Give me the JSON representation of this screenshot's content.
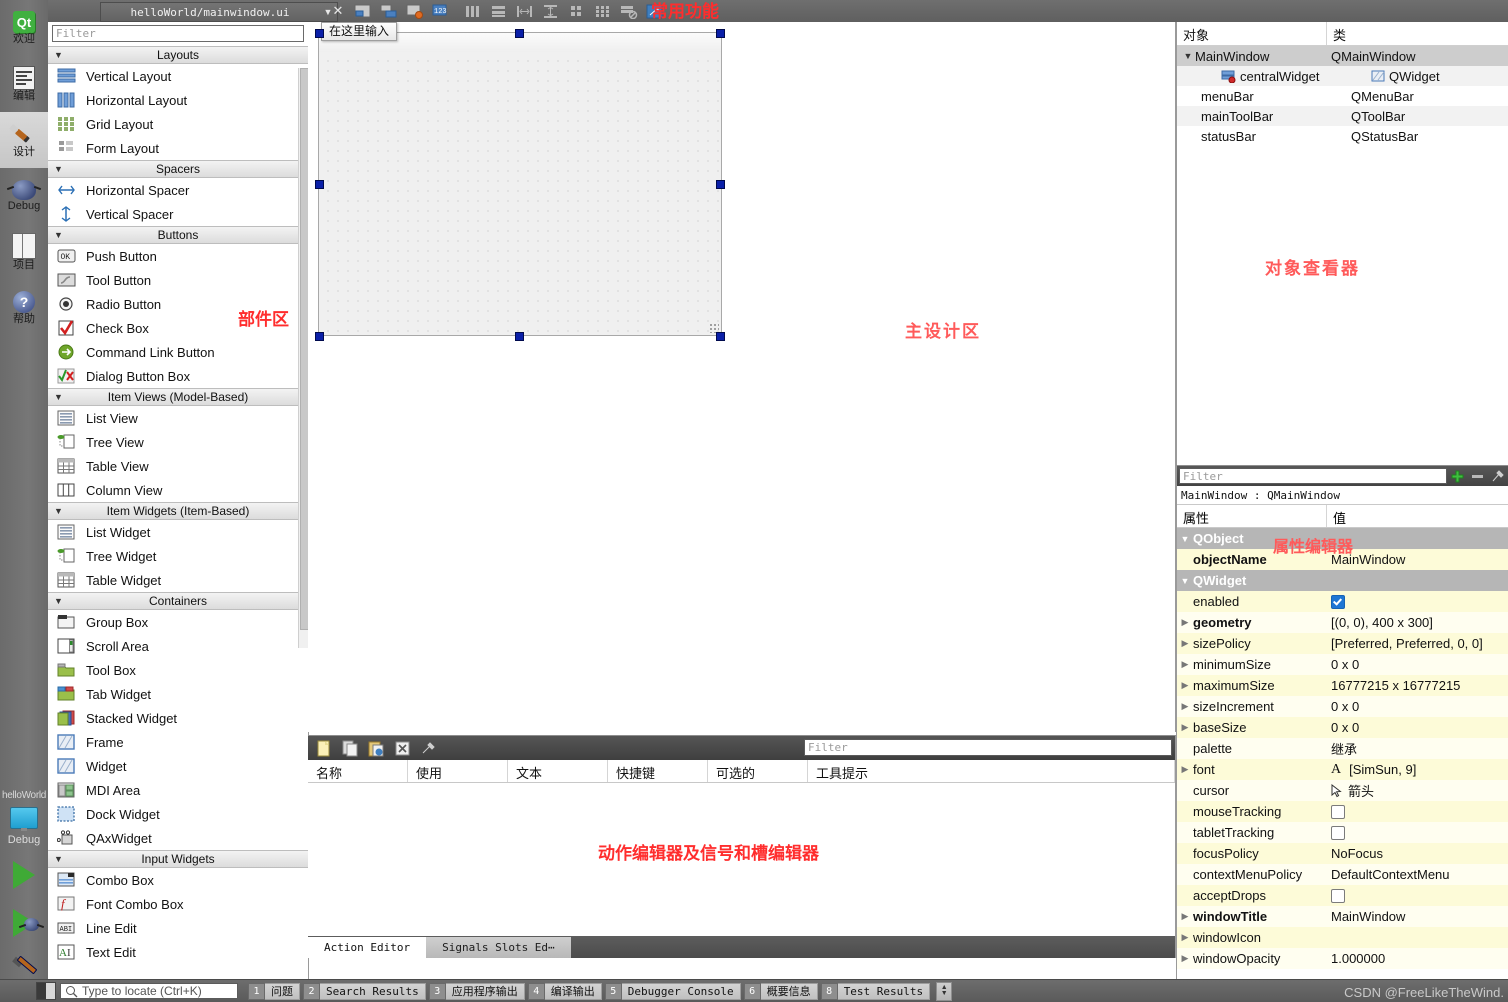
{
  "modebar": {
    "items": [
      {
        "label": "欢迎",
        "icon": "qt-welcome-icon",
        "selected": false
      },
      {
        "label": "编辑",
        "icon": "edit-mode-icon",
        "selected": false
      },
      {
        "label": "设计",
        "icon": "design-mode-icon",
        "selected": true
      },
      {
        "label": "Debug",
        "icon": "debug-mode-icon",
        "selected": false
      },
      {
        "label": "项目",
        "icon": "projects-mode-icon",
        "selected": false
      },
      {
        "label": "帮助",
        "icon": "help-mode-icon",
        "selected": false
      }
    ],
    "project_name": "helloWorld",
    "kit_label": "Debug",
    "run_button": "run-button",
    "debug_button": "debug-button",
    "build_button": "build-button"
  },
  "topbar": {
    "file_name": "helloWorld/mainwindow.ui",
    "dropdown_arrow": "▼",
    "close_label": "✕",
    "annotation": "常用功能",
    "tools": [
      "edit-widgets-icon",
      "edit-signals-slots-icon",
      "edit-buddies-icon",
      "edit-tab-order-icon",
      "layout-horizontally-icon",
      "layout-vertically-icon",
      "layout-splitter-horizontal-icon",
      "layout-splitter-vertical-icon",
      "layout-form-icon",
      "layout-grid-icon",
      "break-layout-icon",
      "adjust-size-icon"
    ]
  },
  "widgetbox": {
    "filter_placeholder": "Filter",
    "annotation": "部件区",
    "sections": [
      {
        "title": "Layouts",
        "items": [
          {
            "label": "Vertical Layout",
            "icon": "vertical-layout-icon"
          },
          {
            "label": "Horizontal Layout",
            "icon": "horizontal-layout-icon"
          },
          {
            "label": "Grid Layout",
            "icon": "grid-layout-icon"
          },
          {
            "label": "Form Layout",
            "icon": "form-layout-icon"
          }
        ]
      },
      {
        "title": "Spacers",
        "items": [
          {
            "label": "Horizontal Spacer",
            "icon": "horizontal-spacer-icon"
          },
          {
            "label": "Vertical Spacer",
            "icon": "vertical-spacer-icon"
          }
        ]
      },
      {
        "title": "Buttons",
        "items": [
          {
            "label": "Push Button",
            "icon": "push-button-icon"
          },
          {
            "label": "Tool Button",
            "icon": "tool-button-icon"
          },
          {
            "label": "Radio Button",
            "icon": "radio-button-icon"
          },
          {
            "label": "Check Box",
            "icon": "check-box-icon"
          },
          {
            "label": "Command Link Button",
            "icon": "command-link-button-icon"
          },
          {
            "label": "Dialog Button Box",
            "icon": "dialog-button-box-icon"
          }
        ]
      },
      {
        "title": "Item Views (Model-Based)",
        "items": [
          {
            "label": "List View",
            "icon": "list-view-icon"
          },
          {
            "label": "Tree View",
            "icon": "tree-view-icon"
          },
          {
            "label": "Table View",
            "icon": "table-view-icon"
          },
          {
            "label": "Column View",
            "icon": "column-view-icon"
          }
        ]
      },
      {
        "title": "Item Widgets (Item-Based)",
        "items": [
          {
            "label": "List Widget",
            "icon": "list-widget-icon"
          },
          {
            "label": "Tree Widget",
            "icon": "tree-widget-icon"
          },
          {
            "label": "Table Widget",
            "icon": "table-widget-icon"
          }
        ]
      },
      {
        "title": "Containers",
        "items": [
          {
            "label": "Group Box",
            "icon": "group-box-icon"
          },
          {
            "label": "Scroll Area",
            "icon": "scroll-area-icon"
          },
          {
            "label": "Tool Box",
            "icon": "tool-box-icon"
          },
          {
            "label": "Tab Widget",
            "icon": "tab-widget-icon"
          },
          {
            "label": "Stacked Widget",
            "icon": "stacked-widget-icon"
          },
          {
            "label": "Frame",
            "icon": "frame-icon"
          },
          {
            "label": "Widget",
            "icon": "widget-icon"
          },
          {
            "label": "MDI Area",
            "icon": "mdi-area-icon"
          },
          {
            "label": "Dock Widget",
            "icon": "dock-widget-icon"
          },
          {
            "label": "QAxWidget",
            "icon": "qax-widget-icon"
          }
        ]
      },
      {
        "title": "Input Widgets",
        "items": [
          {
            "label": "Combo Box",
            "icon": "combo-box-icon"
          },
          {
            "label": "Font Combo Box",
            "icon": "font-combo-box-icon"
          },
          {
            "label": "Line Edit",
            "icon": "line-edit-icon"
          },
          {
            "label": "Text Edit",
            "icon": "text-edit-icon"
          }
        ]
      }
    ]
  },
  "designer": {
    "type_here_label": "在这里输入",
    "annotation": "主设计区"
  },
  "action_editor": {
    "filter_placeholder": "Filter",
    "annotation": "动作编辑器及信号和槽编辑器",
    "columns": [
      "名称",
      "使用",
      "文本",
      "快捷键",
      "可选的",
      "工具提示"
    ],
    "tools": [
      "new-action-icon",
      "copy-action-icon",
      "paste-action-icon",
      "delete-action-icon",
      "configure-icon"
    ],
    "tabs": [
      {
        "label": "Action Editor",
        "active": true
      },
      {
        "label": "Signals  Slots Ed⋯",
        "active": false
      }
    ]
  },
  "object_inspector": {
    "annotation": "对象查看器",
    "columns": [
      "对象",
      "类"
    ],
    "rows": [
      {
        "name": "MainWindow",
        "class": "QMainWindow",
        "depth": 0,
        "expanded": true,
        "selected": true,
        "icon": ""
      },
      {
        "name": "centralWidget",
        "class": "QWidget",
        "depth": 2,
        "expanded": false,
        "selected": false,
        "icon": "central-widget-icon"
      },
      {
        "name": "menuBar",
        "class": "QMenuBar",
        "depth": 1,
        "expanded": false,
        "selected": false,
        "icon": ""
      },
      {
        "name": "mainToolBar",
        "class": "QToolBar",
        "depth": 1,
        "expanded": false,
        "selected": false,
        "icon": ""
      },
      {
        "name": "statusBar",
        "class": "QStatusBar",
        "depth": 1,
        "expanded": false,
        "selected": false,
        "icon": ""
      }
    ]
  },
  "property_editor": {
    "annotation": "属性编辑器",
    "filter_placeholder": "Filter",
    "object_header": "MainWindow : QMainWindow",
    "columns": [
      "属性",
      "值"
    ],
    "add_button": "add-property-icon",
    "remove_button": "remove-property-icon",
    "configure_button": "configure-property-icon",
    "rows": [
      {
        "name": "QObject",
        "value": "",
        "type": "group",
        "expandable": true,
        "bold": true
      },
      {
        "name": "objectName",
        "value": "MainWindow",
        "type": "text",
        "expandable": false,
        "bold": true
      },
      {
        "name": "QWidget",
        "value": "",
        "type": "group",
        "expandable": true,
        "bold": true
      },
      {
        "name": "enabled",
        "value": "",
        "type": "checkbox-checked",
        "expandable": false,
        "bold": false
      },
      {
        "name": "geometry",
        "value": "[(0, 0), 400 x 300]",
        "type": "text",
        "expandable": true,
        "bold": true
      },
      {
        "name": "sizePolicy",
        "value": "[Preferred, Preferred, 0, 0]",
        "type": "text",
        "expandable": true,
        "bold": false
      },
      {
        "name": "minimumSize",
        "value": "0 x 0",
        "type": "text",
        "expandable": true,
        "bold": false
      },
      {
        "name": "maximumSize",
        "value": "16777215 x 16777215",
        "type": "text",
        "expandable": true,
        "bold": false
      },
      {
        "name": "sizeIncrement",
        "value": "0 x 0",
        "type": "text",
        "expandable": true,
        "bold": false
      },
      {
        "name": "baseSize",
        "value": "0 x 0",
        "type": "text",
        "expandable": true,
        "bold": false
      },
      {
        "name": "palette",
        "value": "继承",
        "type": "text",
        "expandable": false,
        "bold": false
      },
      {
        "name": "font",
        "value": "[SimSun, 9]",
        "type": "font",
        "expandable": true,
        "bold": false
      },
      {
        "name": "cursor",
        "value": "箭头",
        "type": "cursor",
        "expandable": false,
        "bold": false
      },
      {
        "name": "mouseTracking",
        "value": "",
        "type": "checkbox",
        "expandable": false,
        "bold": false
      },
      {
        "name": "tabletTracking",
        "value": "",
        "type": "checkbox",
        "expandable": false,
        "bold": false
      },
      {
        "name": "focusPolicy",
        "value": "NoFocus",
        "type": "text",
        "expandable": false,
        "bold": false
      },
      {
        "name": "contextMenuPolicy",
        "value": "DefaultContextMenu",
        "type": "text",
        "expandable": false,
        "bold": false
      },
      {
        "name": "acceptDrops",
        "value": "",
        "type": "checkbox",
        "expandable": false,
        "bold": false
      },
      {
        "name": "windowTitle",
        "value": "MainWindow",
        "type": "text",
        "expandable": true,
        "bold": true
      },
      {
        "name": "windowIcon",
        "value": "",
        "type": "text",
        "expandable": true,
        "bold": false
      },
      {
        "name": "windowOpacity",
        "value": "1.000000",
        "type": "text",
        "expandable": true,
        "bold": false
      }
    ]
  },
  "statusbar": {
    "locator_placeholder": "Type to locate (Ctrl+K)",
    "tabs": [
      {
        "num": "1",
        "label": "问题"
      },
      {
        "num": "2",
        "label": "Search Results"
      },
      {
        "num": "3",
        "label": "应用程序输出"
      },
      {
        "num": "4",
        "label": "编译输出"
      },
      {
        "num": "5",
        "label": "Debugger Console"
      },
      {
        "num": "6",
        "label": "概要信息"
      },
      {
        "num": "8",
        "label": "Test Results"
      }
    ],
    "watermark": "CSDN @FreeLikeTheWind."
  }
}
